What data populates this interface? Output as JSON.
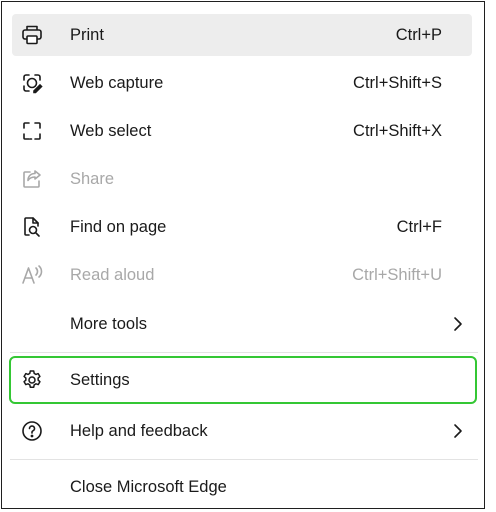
{
  "menu": {
    "items": [
      {
        "label": "Print",
        "shortcut": "Ctrl+P",
        "icon": "printer-icon",
        "enabled": true
      },
      {
        "label": "Web capture",
        "shortcut": "Ctrl+Shift+S",
        "icon": "web-capture-icon",
        "enabled": true
      },
      {
        "label": "Web select",
        "shortcut": "Ctrl+Shift+X",
        "icon": "web-select-icon",
        "enabled": true
      },
      {
        "label": "Share",
        "shortcut": "",
        "icon": "share-icon",
        "enabled": false
      },
      {
        "label": "Find on page",
        "shortcut": "Ctrl+F",
        "icon": "find-on-page-icon",
        "enabled": true
      },
      {
        "label": "Read aloud",
        "shortcut": "Ctrl+Shift+U",
        "icon": "read-aloud-icon",
        "enabled": false
      },
      {
        "label": "More tools",
        "shortcut": "",
        "icon": "",
        "enabled": true,
        "submenu": true
      },
      {
        "label": "Settings",
        "shortcut": "",
        "icon": "gear-icon",
        "enabled": true
      },
      {
        "label": "Help and feedback",
        "shortcut": "",
        "icon": "help-icon",
        "enabled": true,
        "submenu": true
      },
      {
        "label": "Close Microsoft Edge",
        "shortcut": "",
        "icon": "",
        "enabled": true
      }
    ]
  },
  "colors": {
    "hover_background": "#ededed",
    "disabled_text": "#a8a8a8",
    "highlight_outline": "#34c734",
    "divider": "#e3e3e3"
  }
}
